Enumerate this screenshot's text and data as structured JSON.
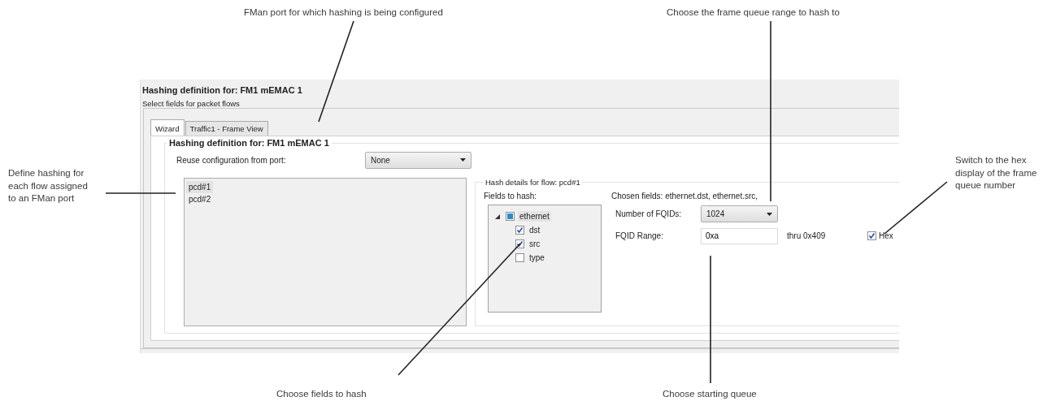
{
  "callouts": [
    {
      "lines": [
        "FMan port for which hashing is being configured"
      ]
    },
    {
      "lines": [
        "Choose the frame queue range to hash to"
      ]
    },
    {
      "lines": [
        "Define hashing for",
        "each flow assigned",
        "to an FMan port"
      ]
    },
    {
      "lines": [
        "Switch to the hex",
        "display of the frame",
        "queue number"
      ]
    },
    {
      "lines": [
        "Choose fields to hash"
      ]
    },
    {
      "lines": [
        "Choose starting queue"
      ]
    }
  ],
  "window": {
    "title": "Hashing definition for: FM1 mEMAC 1",
    "subtitle": "Select fields for packet flows"
  },
  "tabs": [
    {
      "label": "Wizard",
      "selected": true
    },
    {
      "label": "Traffic1 - Frame View",
      "selected": false
    }
  ],
  "group": {
    "title": "Hashing definition for: FM1 mEMAC 1",
    "reuse_label": "Reuse configuration from port:",
    "reuse_value": "None"
  },
  "flows": [
    {
      "label": "pcd#1",
      "selected": true
    },
    {
      "label": "pcd#2",
      "selected": false
    }
  ],
  "hash_details": {
    "title": "Hash details for flow: pcd#1",
    "fields_label": "Fields to hash:",
    "tree": [
      {
        "label": "ethernet",
        "expanded": true,
        "partial": true,
        "selected": true,
        "children": [
          {
            "label": "dst",
            "checked": true,
            "selected": false
          },
          {
            "label": "src",
            "checked": true,
            "selected": false
          },
          {
            "label": "type",
            "checked": false,
            "selected": false
          }
        ]
      }
    ],
    "chosen_fields": "Chosen fields: ethernet.dst, ethernet.src,",
    "fqid_count_label": "Number of FQIDs:",
    "fqid_count_value": "1024",
    "fqid_range_label": "FQID Range:",
    "fqid_range_value": "0xa",
    "thru": "thru 0x409",
    "hex": {
      "label": "Hex",
      "checked": true
    }
  }
}
